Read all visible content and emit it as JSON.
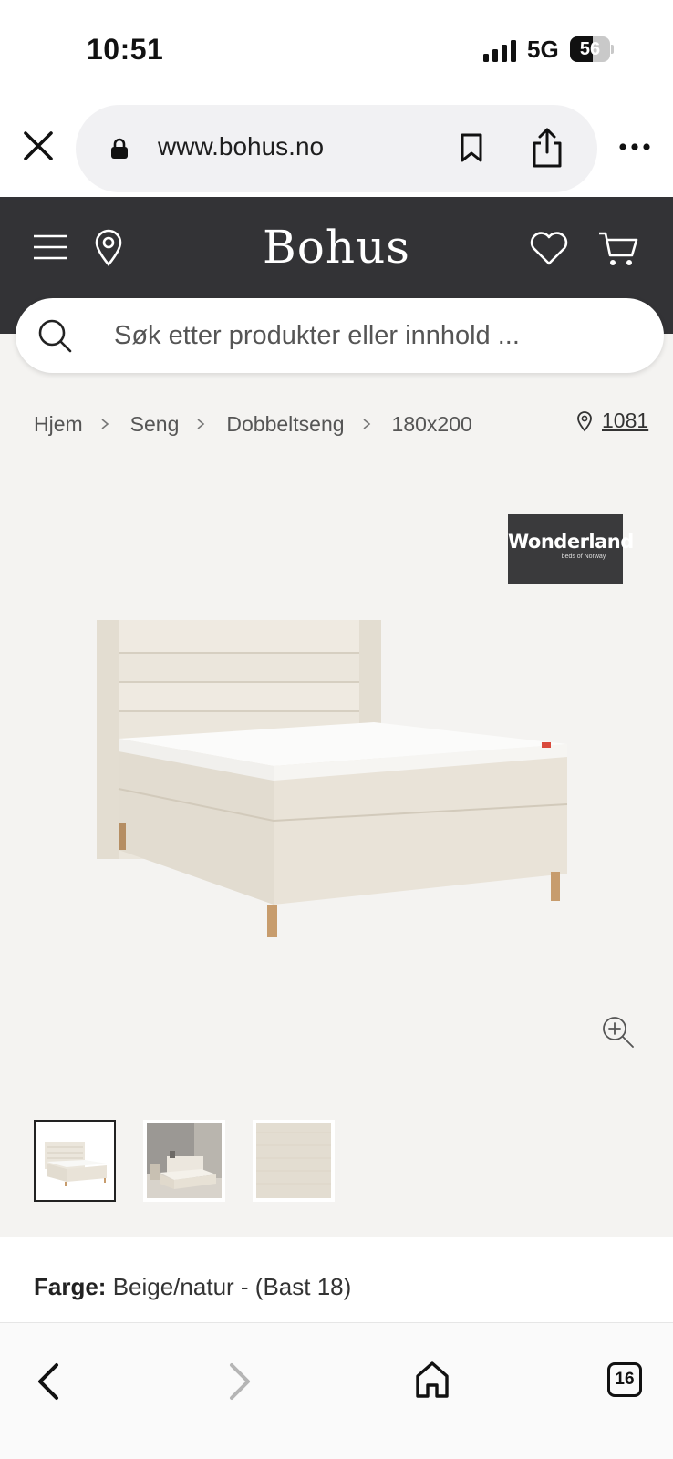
{
  "status_bar": {
    "time": "10:51",
    "network": "5G",
    "battery": "56",
    "battery_level": 0.56
  },
  "browser": {
    "url": "www.bohus.no"
  },
  "header": {
    "logo": "Bohus"
  },
  "search": {
    "placeholder": "Søk etter produkter eller innhold ..."
  },
  "breadcrumb": {
    "items": [
      "Hjem",
      "Seng",
      "Dobbeltseng",
      "180x200"
    ]
  },
  "store": {
    "label": "1081"
  },
  "brand": {
    "name": "Wonderland",
    "tagline": "beds of Norway"
  },
  "product": {
    "image_alt": "product-image",
    "thumbnails_count": 3,
    "active_thumbnail": 0
  },
  "color": {
    "label": "Farge:",
    "value": "Beige/natur - (Bast 18)"
  },
  "bottom_bar": {
    "tabs_count": "16"
  },
  "colors": {
    "header_bg": "#333336",
    "page_bg": "#f4f3f1",
    "fabric": "#e7e2d8"
  }
}
